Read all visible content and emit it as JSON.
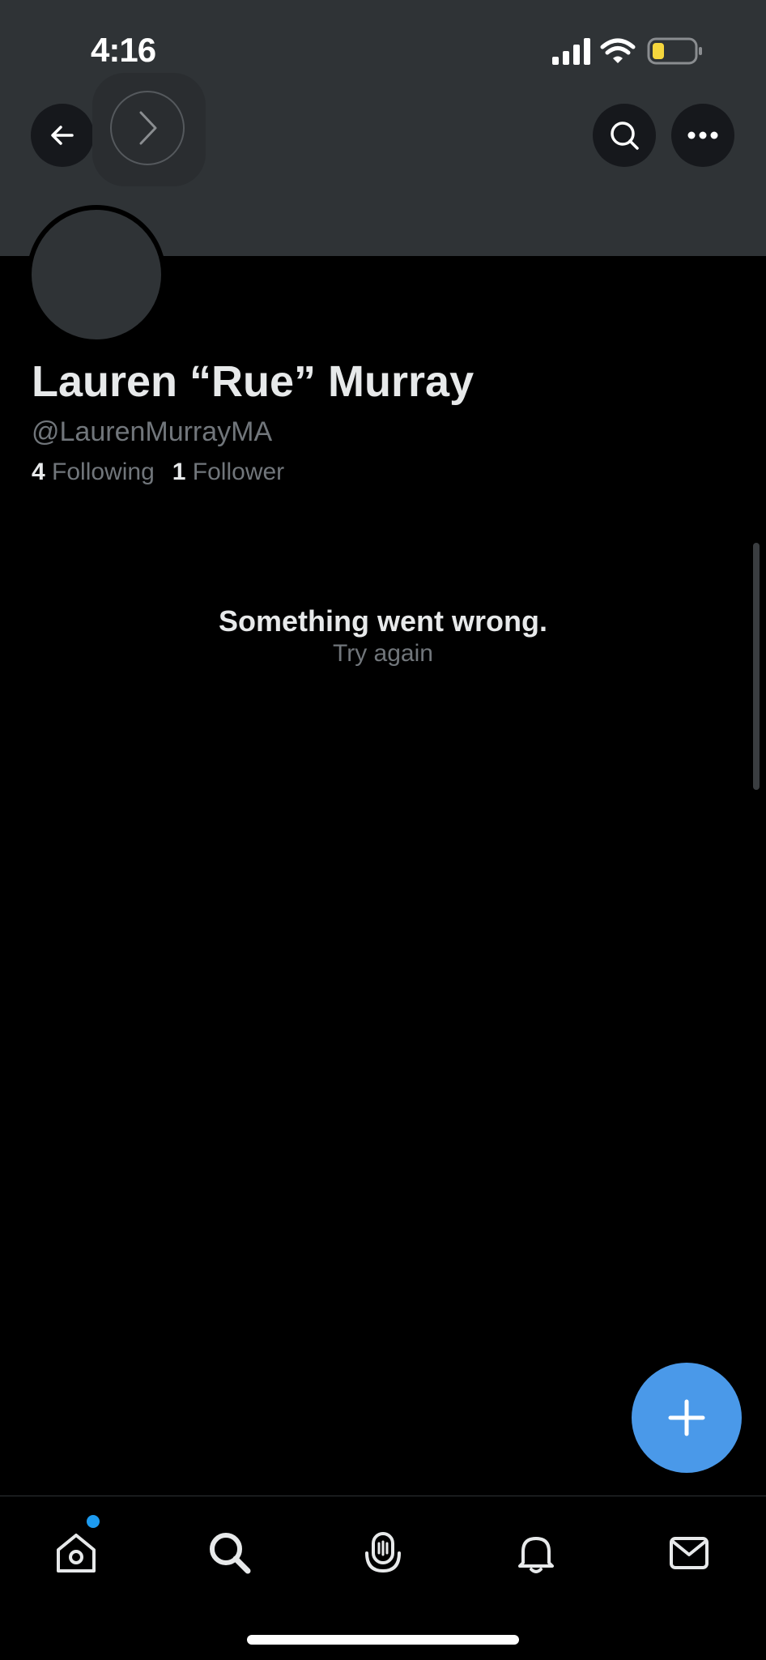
{
  "status_bar": {
    "time": "4:16"
  },
  "profile": {
    "name": "Lauren “Rue” Murray",
    "handle": "@LaurenMurrayMA",
    "following_count": "4",
    "following_label": "Following",
    "followers_count": "1",
    "followers_label": "Follower"
  },
  "error": {
    "title": "Something went wrong.",
    "retry": "Try again"
  },
  "icons": {
    "back": "arrow-left-icon",
    "forward": "chevron-right-icon",
    "search": "search-icon",
    "more": "more-icon",
    "compose": "plus-icon",
    "tabs": [
      "home-icon",
      "search-icon",
      "spaces-icon",
      "bell-icon",
      "mail-icon"
    ]
  },
  "colors": {
    "accent": "#4a99e9",
    "notification_dot": "#1d9bf0",
    "battery_level": "#f5d63d"
  }
}
